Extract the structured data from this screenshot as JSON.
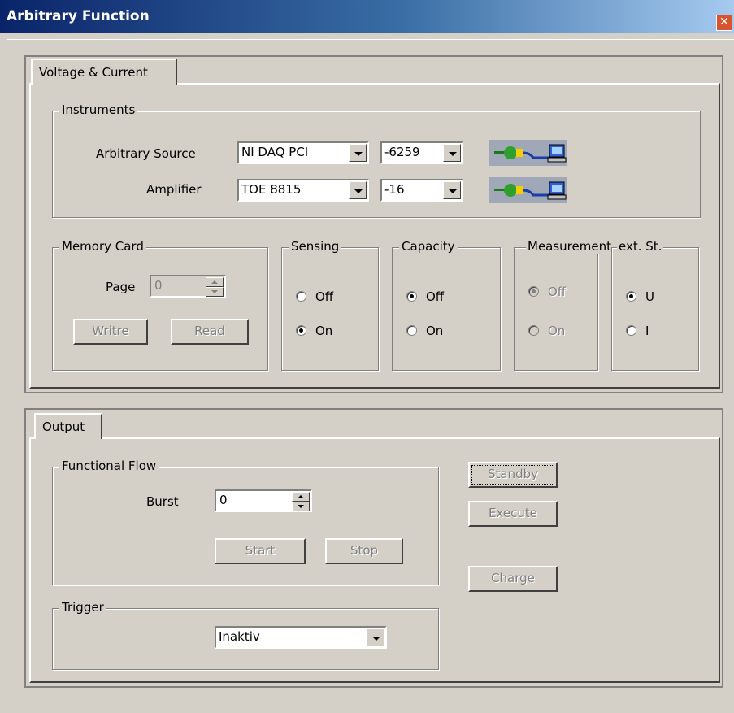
{
  "window": {
    "title": "Arbitrary Function",
    "close_icon": "close-icon"
  },
  "voltage_current": {
    "tab_label": "Voltage & Current",
    "instruments": {
      "legend": "Instruments",
      "rows": [
        {
          "label": "Arbitrary Source",
          "device": "NI DAQ PCI",
          "model": "-6259",
          "connect_icon": "plug-connected-icon"
        },
        {
          "label": "Amplifier",
          "device": "TOE 8815",
          "model": "-16",
          "connect_icon": "plug-connected-icon"
        }
      ]
    },
    "memory_card": {
      "legend": "Memory Card",
      "page_label": "Page",
      "page_value": "0",
      "write_label": "Writre",
      "read_label": "Read"
    },
    "sensing": {
      "legend": "Sensing",
      "options": [
        "Off",
        "On"
      ],
      "selected": "On"
    },
    "capacity": {
      "legend": "Capacity",
      "options": [
        "Off",
        "On"
      ],
      "selected": "Off"
    },
    "measurement": {
      "legend": "Measurement",
      "options": [
        "Off",
        "On"
      ],
      "selected": "Off"
    },
    "ext_st": {
      "legend": "ext. St.",
      "options": [
        "U",
        "I"
      ],
      "selected": "U"
    }
  },
  "output": {
    "tab_label": "Output",
    "functional_flow": {
      "legend": "Functional Flow",
      "burst_label": "Burst",
      "burst_value": "0",
      "start_label": "Start",
      "stop_label": "Stop"
    },
    "trigger": {
      "legend": "Trigger",
      "value": "Inaktiv"
    },
    "buttons": {
      "standby": "Standby",
      "execute": "Execute",
      "charge": "Charge"
    }
  }
}
